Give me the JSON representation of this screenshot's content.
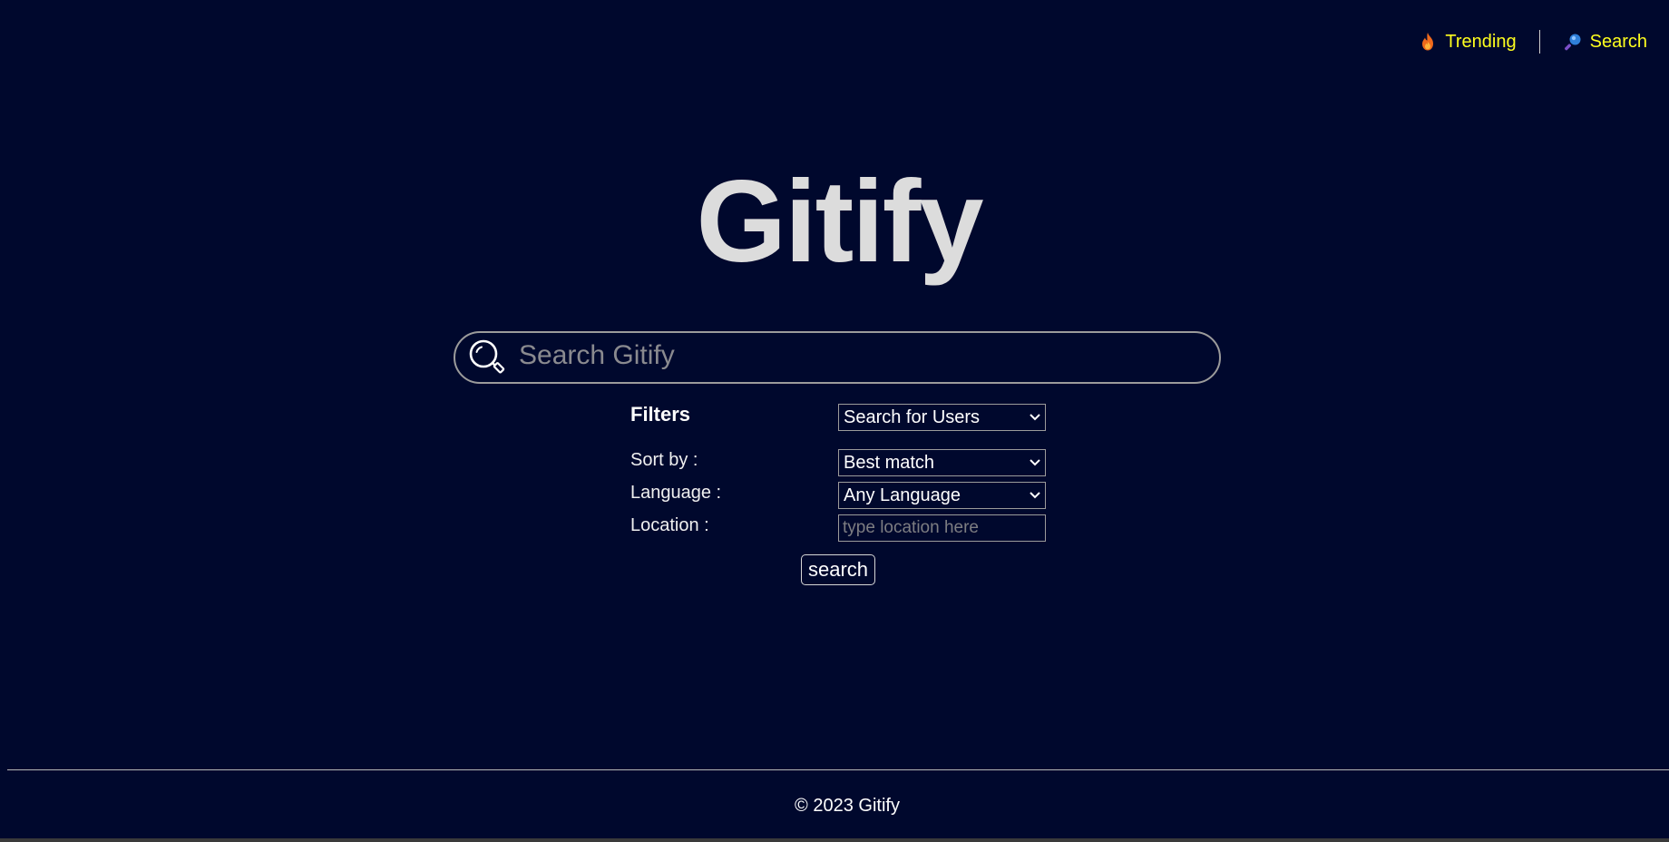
{
  "nav": {
    "trending_label": "Trending",
    "trending_icon": "fire-icon",
    "search_label": "Search",
    "search_icon": "magnifier-icon",
    "link_color": "#ffff1e"
  },
  "logo": {
    "text": "Gitify"
  },
  "searchbar": {
    "icon": "search-icon",
    "placeholder": "Search Gitify",
    "value": ""
  },
  "filters": {
    "heading": "Filters",
    "type_select": "Search for Users",
    "sort_label": "Sort by :",
    "sort_select": "Best match",
    "language_label": "Language :",
    "language_select": "Any Language",
    "location_label": "Location :",
    "location_placeholder": "type location here",
    "location_value": ""
  },
  "search_button": {
    "label": "search"
  },
  "footer": {
    "text": "© 2023 Gitify"
  },
  "colors": {
    "background": "#00082d",
    "logo": "#dcdcdc",
    "nav_link": "#ffff1e"
  }
}
